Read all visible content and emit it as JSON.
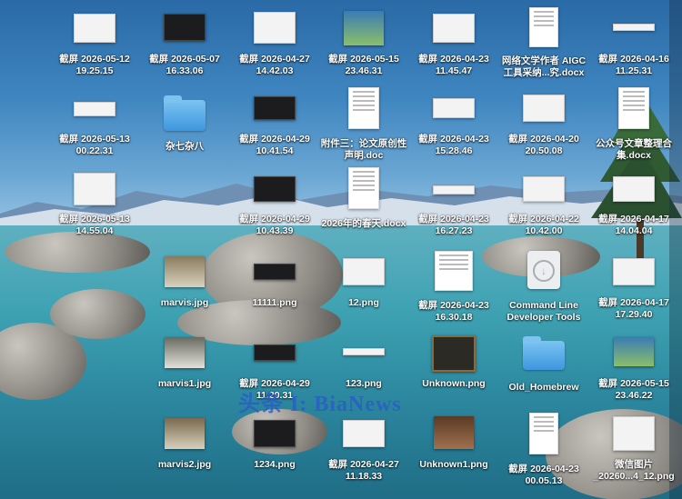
{
  "desktop": {
    "watermark": "头条 I: BiaNews",
    "icons": [
      {
        "label": "截屏 2026-05-12\n19.25.15",
        "icon": "screenshot-icon"
      },
      {
        "label": "截屏 2026-05-07\n16.33.06",
        "icon": "screenshot-icon"
      },
      {
        "label": "截屏 2026-04-27\n14.42.03",
        "icon": "screenshot-icon"
      },
      {
        "label": "截屏 2026-05-15\n23.46.31",
        "icon": "screenshot-icon"
      },
      {
        "label": "截屏 2026-04-23\n11.45.47",
        "icon": "screenshot-icon"
      },
      {
        "label": "网络文学作者 AIGC\n工具采纳...究.docx",
        "icon": "docx-icon"
      },
      {
        "label": "截屏 2026-04-16\n11.25.31",
        "icon": "screenshot-icon"
      },
      {
        "label": "截屏 2026-05-13\n00.22.31",
        "icon": "screenshot-icon"
      },
      {
        "label": "杂七杂八",
        "icon": "folder-icon"
      },
      {
        "label": "截屏 2026-04-29\n10.41.54",
        "icon": "screenshot-icon"
      },
      {
        "label": "附件三：论文原创性\n声明.doc",
        "icon": "doc-icon"
      },
      {
        "label": "截屏 2026-04-23\n15.28.46",
        "icon": "screenshot-icon"
      },
      {
        "label": "截屏 2026-04-20\n20.50.08",
        "icon": "screenshot-icon"
      },
      {
        "label": "公众号文章整理合\n集.docx",
        "icon": "docx-icon"
      },
      {
        "label": "截屏 2026-05-13\n14.55.04",
        "icon": "screenshot-icon"
      },
      {
        "label": "截屏 2026-04-29\n10.43.39",
        "icon": "screenshot-icon"
      },
      {
        "label": "2026年的春天.docx",
        "icon": "docx-icon"
      },
      {
        "label": "截屏 2026-04-23\n16.27.23",
        "icon": "screenshot-icon"
      },
      {
        "label": "截屏 2026-04-22\n10.42.00",
        "icon": "screenshot-icon"
      },
      {
        "label": "截屏 2026-04-17\n14.04.04",
        "icon": "screenshot-icon"
      },
      {
        "label": "marvis.jpg",
        "icon": "image-icon"
      },
      {
        "label": "11111.png",
        "icon": "image-icon"
      },
      {
        "label": "12.png",
        "icon": "image-icon"
      },
      {
        "label": "截屏 2026-04-23\n16.30.18",
        "icon": "screenshot-icon"
      },
      {
        "label": "Command Line\nDeveloper Tools",
        "icon": "disk-image-icon"
      },
      {
        "label": "截屏 2026-04-17\n17.29.40",
        "icon": "screenshot-icon"
      },
      {
        "label": "marvis1.jpg",
        "icon": "image-icon"
      },
      {
        "label": "截屏 2026-04-29\n11.29.31",
        "icon": "screenshot-icon"
      },
      {
        "label": "123.png",
        "icon": "image-icon"
      },
      {
        "label": "Unknown.png",
        "icon": "image-icon"
      },
      {
        "label": "Old_Homebrew",
        "icon": "folder-icon"
      },
      {
        "label": "截屏 2026-05-15\n23.46.22",
        "icon": "screenshot-icon"
      },
      {
        "label": "marvis2.jpg",
        "icon": "image-icon"
      },
      {
        "label": "1234.png",
        "icon": "image-icon"
      },
      {
        "label": "截屏 2026-04-27\n11.18.33",
        "icon": "screenshot-icon"
      },
      {
        "label": "Unknown1.png",
        "icon": "image-icon"
      },
      {
        "label": "截屏 2026-04-23\n00.05.13",
        "icon": "screenshot-icon"
      },
      {
        "label": "微信图片\n_20260...4_12.png",
        "icon": "image-icon"
      }
    ]
  }
}
